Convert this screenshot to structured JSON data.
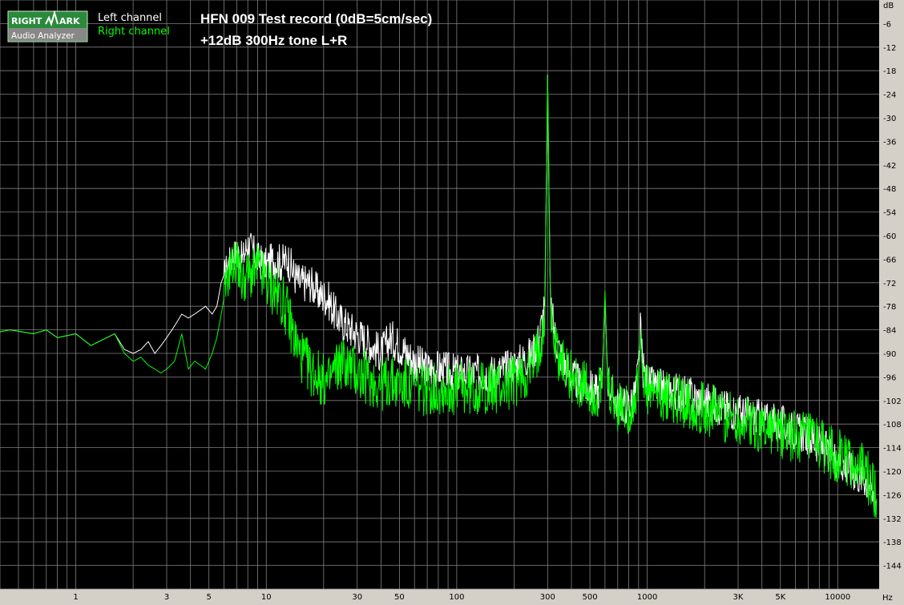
{
  "logo": {
    "line1_left": "RIGHT",
    "line1_right": "ARK",
    "line2": "Audio Analyzer"
  },
  "legend": {
    "left": "Left channel",
    "right": "Right channel"
  },
  "colors": {
    "left": "#ffffff",
    "right": "#00ff00",
    "background": "#000000",
    "grid": "#808080",
    "frame": "#d4d0c8"
  },
  "chart_data": {
    "type": "line",
    "title": "HFN 009 Test record (0dB=5cm/sec)",
    "subtitle": "+12dB 300Hz tone L+R",
    "xlabel": "Hz",
    "ylabel": "dB",
    "xscale": "log",
    "xlim": [
      0.4,
      16500
    ],
    "ylim": [
      -150,
      0
    ],
    "x_ticks": [
      1,
      3,
      5,
      10,
      30,
      50,
      100,
      300,
      500,
      1000,
      3000,
      5000,
      10000
    ],
    "x_tick_labels": [
      "1",
      "3",
      "5",
      "10",
      "30",
      "50",
      "100",
      "300",
      "500",
      "1000",
      "3K",
      "5K",
      "10000"
    ],
    "y_ticks": [
      -6,
      -12,
      -18,
      -24,
      -30,
      -36,
      -42,
      -48,
      -54,
      -60,
      -66,
      -72,
      -78,
      -84,
      -90,
      -96,
      -102,
      -108,
      -114,
      -120,
      -126,
      -132,
      -138,
      -144
    ],
    "grid": true,
    "legend_position": "top-left",
    "series": [
      {
        "name": "Left channel",
        "color": "#ffffff",
        "x": [
          0.4,
          0.45,
          0.6,
          0.7,
          0.8,
          1.0,
          1.2,
          1.6,
          1.8,
          2.0,
          2.2,
          2.4,
          2.6,
          2.8,
          3.0,
          3.3,
          3.6,
          3.9,
          4.2,
          4.5,
          4.8,
          5.2,
          5.5,
          5.8,
          6.2,
          6.5,
          7.0,
          7.5,
          8.0,
          8.5,
          9.0,
          10,
          11,
          12,
          13,
          14,
          15,
          17,
          19,
          21,
          23,
          25,
          28,
          32,
          36,
          40,
          45,
          50,
          55,
          60,
          70,
          80,
          100,
          120,
          150,
          180,
          200,
          220,
          250,
          270,
          290,
          300,
          310,
          330,
          360,
          400,
          450,
          500,
          550,
          580,
          600,
          620,
          650,
          700,
          800,
          850,
          900,
          920,
          950,
          1000,
          1500,
          2000,
          3000,
          5000,
          7000,
          10000,
          12000,
          14000,
          15500,
          16000
        ],
        "y": [
          -84.5,
          -84,
          -85,
          -84,
          -86,
          -85,
          -88,
          -85,
          -89,
          -90,
          -89,
          -87,
          -90,
          -88,
          -86,
          -83,
          -80,
          -81,
          -80,
          -79,
          -78,
          -80,
          -78,
          -72,
          -68,
          -66,
          -64,
          -66,
          -62,
          -64,
          -66,
          -68,
          -66,
          -67,
          -66,
          -70,
          -72,
          -72,
          -75,
          -76,
          -80,
          -82,
          -84,
          -86,
          -88,
          -90,
          -86,
          -88,
          -90,
          -92,
          -94,
          -94,
          -95,
          -95,
          -95,
          -94,
          -93,
          -92,
          -90,
          -86,
          -78,
          -19,
          -78,
          -86,
          -92,
          -96,
          -98,
          -99,
          -100,
          -96,
          -76,
          -96,
          -100,
          -103,
          -103,
          -102,
          -94,
          -84,
          -94,
          -98,
          -100,
          -102,
          -105,
          -108,
          -111,
          -117,
          -120,
          -122,
          -126,
          -128
        ]
      },
      {
        "name": "Right channel",
        "color": "#00ff00",
        "x": [
          0.4,
          0.45,
          0.6,
          0.7,
          0.8,
          1.0,
          1.2,
          1.6,
          1.8,
          2.0,
          2.2,
          2.4,
          2.6,
          2.8,
          3.0,
          3.3,
          3.6,
          3.9,
          4.2,
          4.5,
          4.8,
          5.2,
          5.5,
          5.8,
          6.2,
          6.5,
          7.0,
          7.5,
          8.0,
          8.5,
          9.0,
          10,
          11,
          12,
          13,
          14,
          15,
          17,
          19,
          21,
          23,
          25,
          28,
          32,
          36,
          40,
          45,
          50,
          55,
          60,
          70,
          80,
          100,
          120,
          150,
          180,
          200,
          220,
          250,
          270,
          290,
          300,
          310,
          330,
          360,
          400,
          450,
          500,
          550,
          580,
          600,
          620,
          650,
          700,
          800,
          850,
          900,
          920,
          950,
          1000,
          1500,
          2000,
          3000,
          5000,
          7000,
          10000,
          12000,
          14000,
          15500,
          16000
        ],
        "y": [
          -84.5,
          -84,
          -85,
          -84,
          -86,
          -85,
          -88,
          -85,
          -90,
          -92,
          -91,
          -93,
          -94,
          -95,
          -94,
          -92,
          -85,
          -94,
          -92,
          -93,
          -94,
          -90,
          -86,
          -80,
          -72,
          -68,
          -66,
          -72,
          -70,
          -70,
          -68,
          -72,
          -74,
          -76,
          -80,
          -86,
          -90,
          -94,
          -96,
          -98,
          -94,
          -92,
          -94,
          -96,
          -97,
          -98,
          -97,
          -98,
          -98,
          -99,
          -99,
          -99,
          -99,
          -99,
          -99,
          -98,
          -97,
          -96,
          -94,
          -88,
          -80,
          -19,
          -80,
          -88,
          -93,
          -96,
          -98,
          -100,
          -101,
          -99,
          -74,
          -99,
          -102,
          -104,
          -104,
          -103,
          -98,
          -84,
          -98,
          -100,
          -102,
          -104,
          -107,
          -110,
          -112,
          -116,
          -118,
          -120,
          -125,
          -127
        ]
      }
    ]
  }
}
